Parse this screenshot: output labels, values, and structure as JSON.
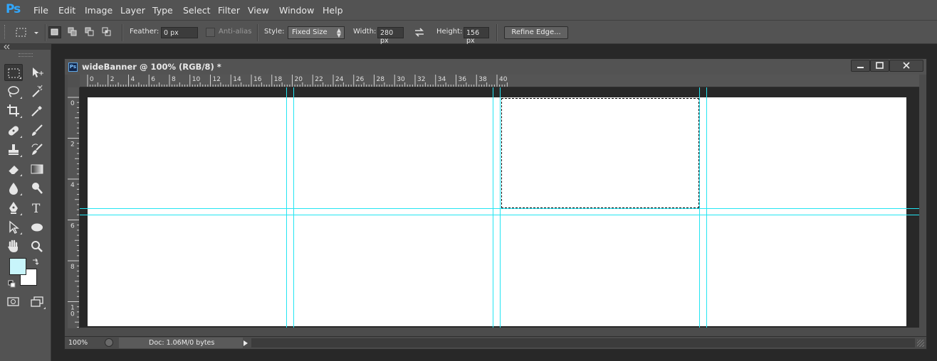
{
  "app": {
    "logo": "Ps"
  },
  "menu": [
    "File",
    "Edit",
    "Image",
    "Layer",
    "Type",
    "Select",
    "Filter",
    "View",
    "Window",
    "Help"
  ],
  "options": {
    "feather_label": "Feather:",
    "feather_value": "0 px",
    "antialias_label": "Anti-alias",
    "style_label": "Style:",
    "style_value": "Fixed Size",
    "width_label": "Width:",
    "width_value": "280 px",
    "height_label": "Height:",
    "height_value": "156 px",
    "refine_label": "Refine Edge..."
  },
  "document": {
    "icon_text": "Ps",
    "title": "wideBanner @ 100% (RGB/8) *",
    "h_ruler_labels": [
      "0",
      "2",
      "4",
      "6",
      "8",
      "10",
      "12",
      "14",
      "16",
      "18",
      "20",
      "22",
      "24",
      "26",
      "28",
      "30",
      "32",
      "34",
      "36",
      "38",
      "40"
    ],
    "v_ruler_labels": [
      "0",
      "2",
      "4",
      "6",
      "8",
      "1\n0"
    ],
    "canvas_color": "#ffffff",
    "guide_color": "#23e5f2"
  },
  "status": {
    "zoom": "100%",
    "doc_info": "Doc: 1.06M/0 bytes"
  },
  "colors": {
    "foreground": "#c8f5fb",
    "background": "#ffffff"
  },
  "tools": [
    [
      "rectangular-marquee-icon",
      "move-icon"
    ],
    [
      "lasso-icon",
      "magic-wand-icon"
    ],
    [
      "crop-icon",
      "eyedropper-icon"
    ],
    [
      "healing-brush-icon",
      "brush-icon"
    ],
    [
      "clone-stamp-icon",
      "history-brush-icon"
    ],
    [
      "eraser-icon",
      "gradient-icon"
    ],
    [
      "blur-icon",
      "dodge-icon"
    ],
    [
      "pen-icon",
      "type-icon"
    ],
    [
      "path-selection-icon",
      "ellipse-icon"
    ],
    [
      "hand-icon",
      "zoom-icon"
    ]
  ]
}
